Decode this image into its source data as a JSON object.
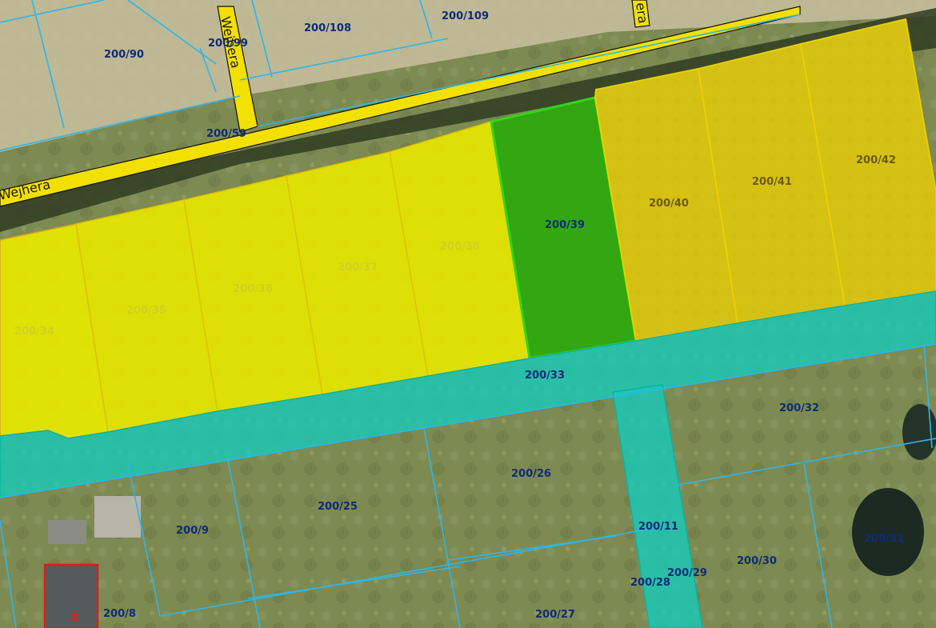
{
  "map": {
    "street_labels": [
      "Wejhera",
      "Wejhera",
      "era"
    ],
    "parcels": {
      "p200_90": "200/90",
      "p200_99": "200/99",
      "p200_108": "200/108",
      "p200_109": "200/109",
      "p200_59": "200/59",
      "p200_34": "200/34",
      "p200_35": "200/35",
      "p200_36": "200/36",
      "p200_37": "200/37",
      "p200_38": "200/38",
      "p200_39": "200/39",
      "p200_40": "200/40",
      "p200_41": "200/41",
      "p200_42": "200/42",
      "p200_33": "200/33",
      "p200_32": "200/32",
      "p200_26": "200/26",
      "p200_25": "200/25",
      "p200_9": "200/9",
      "p200_11": "200/11",
      "p200_29": "200/29",
      "p200_28": "200/28",
      "p200_30": "200/30",
      "p200_31": "200/31",
      "p200_8": "200/8",
      "p200_27": "200/27"
    },
    "building_marker": "g",
    "colors": {
      "road": "#f2e000",
      "parcel_yellow_light": "#e6e600",
      "parcel_selected_green": "#2ea90f",
      "parcel_yellow_dark": "#d9c300",
      "strip_cyan": "#18c9b8",
      "boundary_line": "#2fb6e8",
      "building_outline": "#d42020",
      "label": "#0f2b7a"
    }
  }
}
